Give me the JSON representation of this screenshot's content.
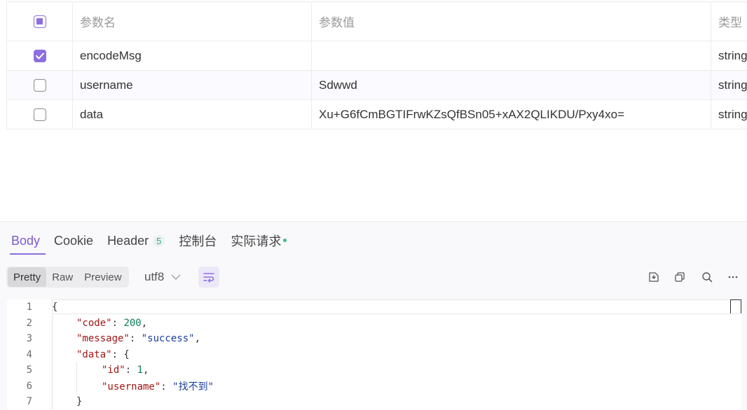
{
  "params": {
    "headers": {
      "name": "参数名",
      "value": "参数值",
      "type": "类型"
    },
    "rows": [
      {
        "checked": true,
        "name": "encodeMsg",
        "value": "",
        "type": "string"
      },
      {
        "checked": false,
        "name": "username",
        "value": "Sdwwd",
        "type": "string"
      },
      {
        "checked": false,
        "name": "data",
        "value": "Xu+G6fCmBGTIFrwKZsQfBSn05+xAX2QLIKDU/Pxy4xo=",
        "type": "string"
      }
    ]
  },
  "response": {
    "tabs": [
      {
        "label": "Body",
        "active": true
      },
      {
        "label": "Cookie"
      },
      {
        "label": "Header",
        "badge": "5"
      },
      {
        "label": "控制台"
      },
      {
        "label": "实际请求",
        "dot": true
      }
    ],
    "view_modes": [
      "Pretty",
      "Raw",
      "Preview"
    ],
    "active_view": "Pretty",
    "encoding": "utf8",
    "toolbar_icons": [
      "save-icon",
      "copy-icon",
      "search-icon",
      "more-icon"
    ],
    "code_lines": [
      {
        "no": "1",
        "text": "{"
      },
      {
        "no": "2",
        "text": "\"code\": 200,"
      },
      {
        "no": "3",
        "text": "\"message\": \"success\","
      },
      {
        "no": "4",
        "text": "\"data\": {"
      },
      {
        "no": "5",
        "text": "\"id\": 1,"
      },
      {
        "no": "6",
        "text": "\"username\": \"找不到\""
      },
      {
        "no": "7",
        "text": "}"
      }
    ]
  },
  "colors": {
    "accent": "#8b6fe0",
    "key": "#a31515",
    "string": "#1b3f9e",
    "number": "#0b7e5a"
  }
}
